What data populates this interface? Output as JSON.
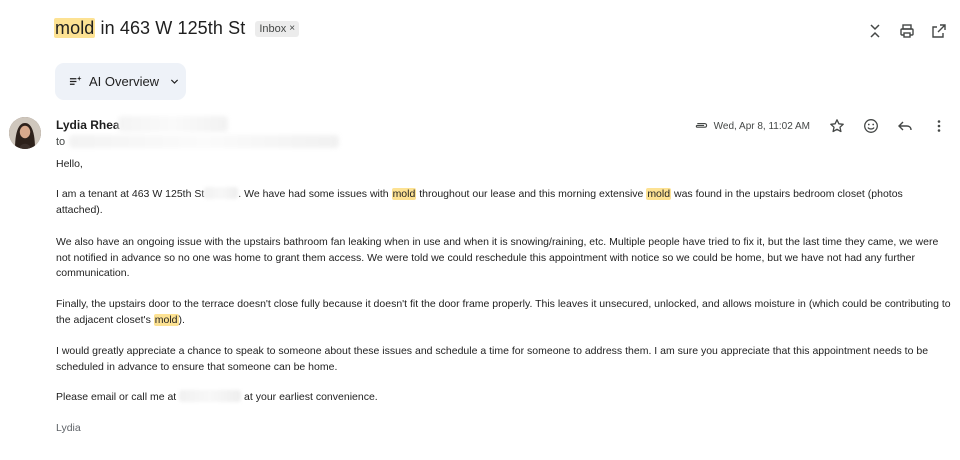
{
  "email": {
    "subject_highlight": "mold",
    "subject_rest": " in 463 W 125th St",
    "label_badge": "Inbox",
    "label_remove": "×"
  },
  "ai_overview": {
    "label": "AI Overview"
  },
  "sender": {
    "name": "Lydia Rhea",
    "to_prefix": "to"
  },
  "meta": {
    "date": "Wed, Apr 8, 11:02 AM"
  },
  "body": {
    "greeting": "Hello,",
    "p1_a": "I am a tenant at 463 W 125th St",
    "p1_b": ". We have had some issues with ",
    "p1_mold1": "mold",
    "p1_c": " throughout our lease and this morning extensive ",
    "p1_mold2": "mold",
    "p1_d": " was found in the upstairs bedroom closet (photos attached).",
    "p2": "We also have an ongoing issue with the upstairs bathroom fan leaking when in use and when it is snowing/raining, etc. Multiple people have tried to fix it, but the last time they came, we were not notified in advance so no one was home to grant them access. We were told we could reschedule this appointment with notice so we could be home, but we have not had any further communication.",
    "p3_a": "Finally, the upstairs door to the terrace doesn't close fully because it doesn't fit the door frame properly. This leaves it unsecured, unlocked, and allows moisture in (which could be contributing to the adjacent closet's ",
    "p3_mold": "mold",
    "p3_b": ").",
    "p4": "I would greatly appreciate a chance to speak to someone about these issues and schedule a time for someone to address them. I am sure you appreciate that this appointment needs to be scheduled in advance to ensure that someone can be home.",
    "p5_a": "Please email or call me at ",
    "p5_b": " at your earliest convenience.",
    "signature": "Lydia"
  },
  "icons": {
    "collapse": "unfold-less-icon",
    "print": "print-icon",
    "open_new": "open-in-new-icon",
    "attachment": "paperclip-icon",
    "star": "star-icon",
    "emoji": "emoji-icon",
    "reply": "reply-icon",
    "more": "more-vert-icon",
    "sparkle": "sparkle-list-icon",
    "chevron": "chevron-down-icon"
  },
  "colors": {
    "highlight": "#fde293",
    "chip_bg": "#eef2f8",
    "text": "#1f1f1f"
  }
}
